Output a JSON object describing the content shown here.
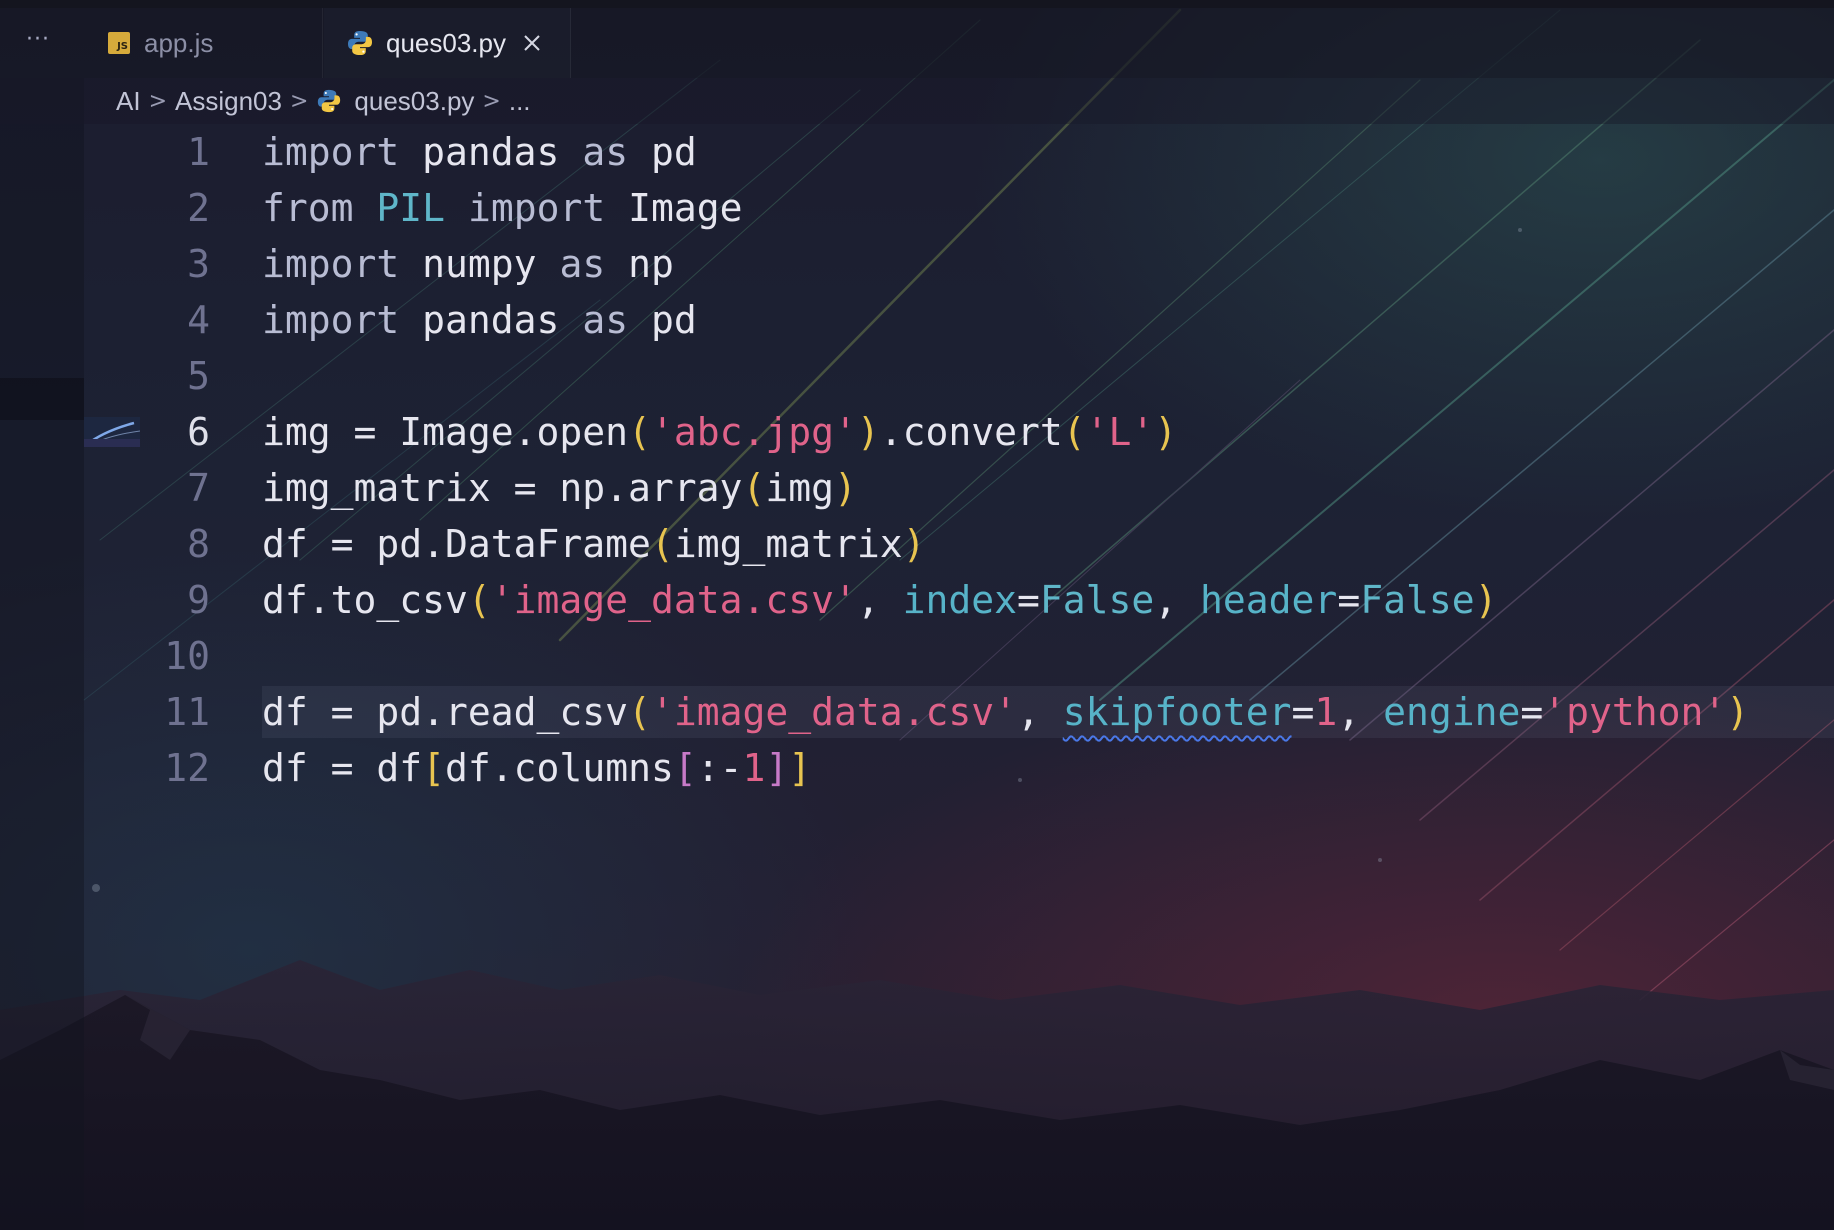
{
  "tabs": [
    {
      "label": "app.js",
      "icon": "js-file-icon",
      "active": false
    },
    {
      "label": "ques03.py",
      "icon": "python-file-icon",
      "active": true
    }
  ],
  "more_label": "···",
  "breadcrumb": {
    "items": [
      "AI",
      "Assign03",
      "ques03.py",
      "..."
    ],
    "separator": ">"
  },
  "editor": {
    "active_line": 6,
    "highlighted_line": 11,
    "lines": [
      {
        "number": "1",
        "tokens": [
          {
            "t": "import",
            "c": "kw"
          },
          {
            "t": " pandas ",
            "c": ""
          },
          {
            "t": "as",
            "c": "kw"
          },
          {
            "t": " pd",
            "c": ""
          }
        ]
      },
      {
        "number": "2",
        "tokens": [
          {
            "t": "from",
            "c": "kw"
          },
          {
            "t": " ",
            "c": ""
          },
          {
            "t": "PIL",
            "c": "mod"
          },
          {
            "t": " ",
            "c": ""
          },
          {
            "t": "import",
            "c": "kw"
          },
          {
            "t": " Image",
            "c": ""
          }
        ]
      },
      {
        "number": "3",
        "tokens": [
          {
            "t": "import",
            "c": "kw"
          },
          {
            "t": " numpy ",
            "c": ""
          },
          {
            "t": "as",
            "c": "kw"
          },
          {
            "t": " np",
            "c": ""
          }
        ]
      },
      {
        "number": "4",
        "tokens": [
          {
            "t": "import",
            "c": "kw"
          },
          {
            "t": " pandas ",
            "c": ""
          },
          {
            "t": "as",
            "c": "kw"
          },
          {
            "t": " pd",
            "c": ""
          }
        ]
      },
      {
        "number": "5",
        "tokens": []
      },
      {
        "number": "6",
        "tokens": [
          {
            "t": "img = Image.open",
            "c": ""
          },
          {
            "t": "(",
            "c": "br"
          },
          {
            "t": "'abc.jpg'",
            "c": "str"
          },
          {
            "t": ")",
            "c": "br"
          },
          {
            "t": ".convert",
            "c": ""
          },
          {
            "t": "(",
            "c": "br"
          },
          {
            "t": "'L'",
            "c": "str"
          },
          {
            "t": ")",
            "c": "br"
          }
        ]
      },
      {
        "number": "7",
        "tokens": [
          {
            "t": "img_matrix = np.array",
            "c": ""
          },
          {
            "t": "(",
            "c": "br"
          },
          {
            "t": "img",
            "c": ""
          },
          {
            "t": ")",
            "c": "br"
          }
        ]
      },
      {
        "number": "8",
        "tokens": [
          {
            "t": "df = pd.DataFrame",
            "c": ""
          },
          {
            "t": "(",
            "c": "br"
          },
          {
            "t": "img_matrix",
            "c": ""
          },
          {
            "t": ")",
            "c": "br"
          }
        ]
      },
      {
        "number": "9",
        "tokens": [
          {
            "t": "df.to_csv",
            "c": ""
          },
          {
            "t": "(",
            "c": "br"
          },
          {
            "t": "'image_data.csv'",
            "c": "str"
          },
          {
            "t": ", ",
            "c": ""
          },
          {
            "t": "index",
            "c": "param"
          },
          {
            "t": "=",
            "c": ""
          },
          {
            "t": "False",
            "c": "const"
          },
          {
            "t": ", ",
            "c": ""
          },
          {
            "t": "header",
            "c": "param"
          },
          {
            "t": "=",
            "c": ""
          },
          {
            "t": "False",
            "c": "const"
          },
          {
            "t": ")",
            "c": "br"
          }
        ]
      },
      {
        "number": "10",
        "tokens": []
      },
      {
        "number": "11",
        "tokens": [
          {
            "t": "df = pd.read_csv",
            "c": ""
          },
          {
            "t": "(",
            "c": "br"
          },
          {
            "t": "'image_data.csv'",
            "c": "str"
          },
          {
            "t": ", ",
            "c": ""
          },
          {
            "t": "skipfooter",
            "c": "param squig"
          },
          {
            "t": "=",
            "c": ""
          },
          {
            "t": "1",
            "c": "num"
          },
          {
            "t": ", ",
            "c": ""
          },
          {
            "t": "engine",
            "c": "param"
          },
          {
            "t": "=",
            "c": ""
          },
          {
            "t": "'python'",
            "c": "str"
          },
          {
            "t": ")",
            "c": "br"
          }
        ]
      },
      {
        "number": "12",
        "tokens": [
          {
            "t": "df = df",
            "c": ""
          },
          {
            "t": "[",
            "c": "br"
          },
          {
            "t": "df.columns",
            "c": ""
          },
          {
            "t": "[",
            "c": "br2"
          },
          {
            "t": ":-",
            "c": ""
          },
          {
            "t": "1",
            "c": "num"
          },
          {
            "t": "]",
            "c": "br2"
          },
          {
            "t": "]",
            "c": "br"
          }
        ]
      }
    ]
  },
  "colors": {
    "keyword": "#b8bcd3",
    "module": "#5fb6c9",
    "string": "#e0638a",
    "bracket": "#e8c450",
    "bracket_nested": "#c77ac8",
    "parameter": "#57b3c8",
    "warning_squiggle": "#4a78e8",
    "js_icon": "#d6aa3b"
  }
}
